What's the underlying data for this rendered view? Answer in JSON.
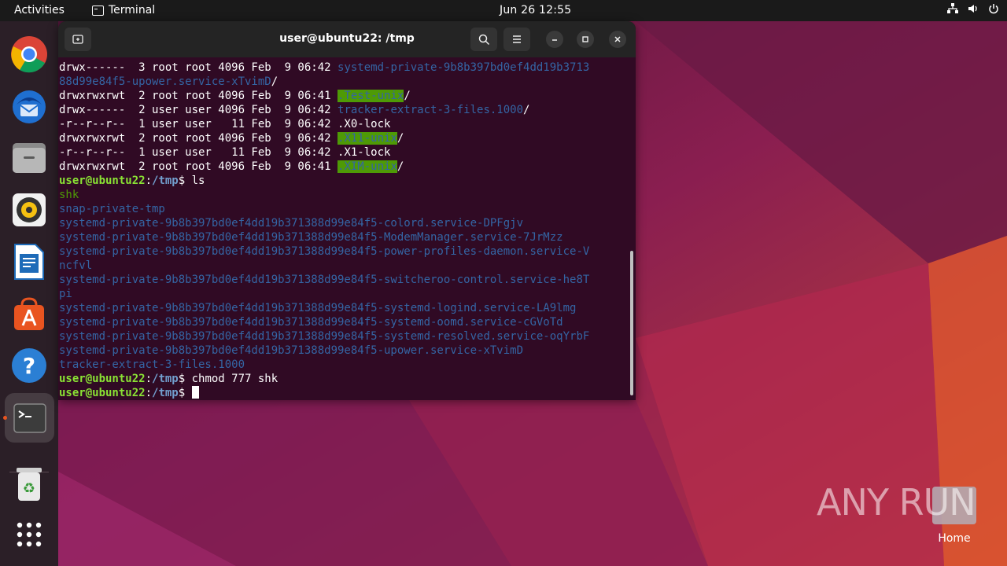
{
  "topbar": {
    "activities": "Activities",
    "app_name": "Terminal",
    "clock": "Jun 26  12:55"
  },
  "terminal": {
    "title": "user@ubuntu22: /tmp",
    "lines": [
      [
        {
          "t": "drwx------  3 root root 4096 Feb  9 06:42 "
        },
        {
          "t": "systemd-private-9b8b397bd0ef4dd19b3713",
          "c": "blue"
        }
      ],
      [
        {
          "t": "88d99e84f5-upower.service-xTvimD",
          "c": "blue"
        },
        {
          "t": "/"
        }
      ],
      [
        {
          "t": "drwxrwxrwt  2 root root 4096 Feb  9 06:41 "
        },
        {
          "t": ".Test-unix",
          "c": "hl"
        },
        {
          "t": "/"
        }
      ],
      [
        {
          "t": "drwx------  2 user user 4096 Feb  9 06:42 "
        },
        {
          "t": "tracker-extract-3-files.1000",
          "c": "blue"
        },
        {
          "t": "/"
        }
      ],
      [
        {
          "t": "-r--r--r--  1 user user   11 Feb  9 06:42 .X0-lock"
        }
      ],
      [
        {
          "t": "drwxrwxrwt  2 root root 4096 Feb  9 06:42 "
        },
        {
          "t": ".X11-unix",
          "c": "hl"
        },
        {
          "t": "/"
        }
      ],
      [
        {
          "t": "-r--r--r--  1 user user   11 Feb  9 06:42 .X1-lock"
        }
      ],
      [
        {
          "t": "drwxrwxrwt  2 root root 4096 Feb  9 06:41 "
        },
        {
          "t": ".XIM-unix",
          "c": "hl"
        },
        {
          "t": "/"
        }
      ],
      [
        {
          "t": "user@ubuntu22",
          "c": "pg"
        },
        {
          "t": ":"
        },
        {
          "t": "/tmp",
          "c": "pb"
        },
        {
          "t": "$ ls"
        }
      ],
      [
        {
          "t": "shk",
          "c": "green"
        }
      ],
      [
        {
          "t": "snap-private-tmp",
          "c": "blue"
        }
      ],
      [
        {
          "t": "systemd-private-9b8b397bd0ef4dd19b371388d99e84f5-colord.service-DPFgjv",
          "c": "blue"
        }
      ],
      [
        {
          "t": "systemd-private-9b8b397bd0ef4dd19b371388d99e84f5-ModemManager.service-7JrMzz",
          "c": "blue"
        }
      ],
      [
        {
          "t": "systemd-private-9b8b397bd0ef4dd19b371388d99e84f5-power-profiles-daemon.service-V",
          "c": "blue"
        }
      ],
      [
        {
          "t": "ncfvl",
          "c": "blue"
        }
      ],
      [
        {
          "t": "systemd-private-9b8b397bd0ef4dd19b371388d99e84f5-switcheroo-control.service-he8T",
          "c": "blue"
        }
      ],
      [
        {
          "t": "pi",
          "c": "blue"
        }
      ],
      [
        {
          "t": "systemd-private-9b8b397bd0ef4dd19b371388d99e84f5-systemd-logind.service-LA9lmg",
          "c": "blue"
        }
      ],
      [
        {
          "t": "systemd-private-9b8b397bd0ef4dd19b371388d99e84f5-systemd-oomd.service-cGVoTd",
          "c": "blue"
        }
      ],
      [
        {
          "t": "systemd-private-9b8b397bd0ef4dd19b371388d99e84f5-systemd-resolved.service-oqYrbF",
          "c": "blue"
        }
      ],
      [
        {
          "t": "systemd-private-9b8b397bd0ef4dd19b371388d99e84f5-upower.service-xTvimD",
          "c": "blue"
        }
      ],
      [
        {
          "t": "tracker-extract-3-files.1000",
          "c": "blue"
        }
      ],
      [
        {
          "t": "user@ubuntu22",
          "c": "pg"
        },
        {
          "t": ":"
        },
        {
          "t": "/tmp",
          "c": "pb"
        },
        {
          "t": "$ chmod 777 shk"
        }
      ],
      [
        {
          "t": "user@ubuntu22",
          "c": "pg"
        },
        {
          "t": ":"
        },
        {
          "t": "/tmp",
          "c": "pb"
        },
        {
          "t": "$ "
        }
      ]
    ]
  },
  "dock": {
    "items": [
      {
        "name": "chrome",
        "icon": "chrome-icon"
      },
      {
        "name": "thunderbird",
        "icon": "thunderbird-icon"
      },
      {
        "name": "files",
        "icon": "files-icon"
      },
      {
        "name": "rhythmbox",
        "icon": "rhythmbox-icon"
      },
      {
        "name": "writer",
        "icon": "writer-icon"
      },
      {
        "name": "app-center",
        "icon": "app-center-icon"
      },
      {
        "name": "help",
        "icon": "help-icon"
      },
      {
        "name": "terminal",
        "icon": "terminal-icon"
      },
      {
        "name": "trash",
        "icon": "trash-icon"
      },
      {
        "name": "show-apps",
        "icon": "grid-icon"
      }
    ]
  },
  "desktop": {
    "home_label": "Home",
    "watermark": "ANY RUN"
  },
  "colors": {
    "terminal_bg": "#300a24",
    "prompt_green": "#8ae234",
    "dir_blue": "#3465a4",
    "accent": "#e95420"
  }
}
